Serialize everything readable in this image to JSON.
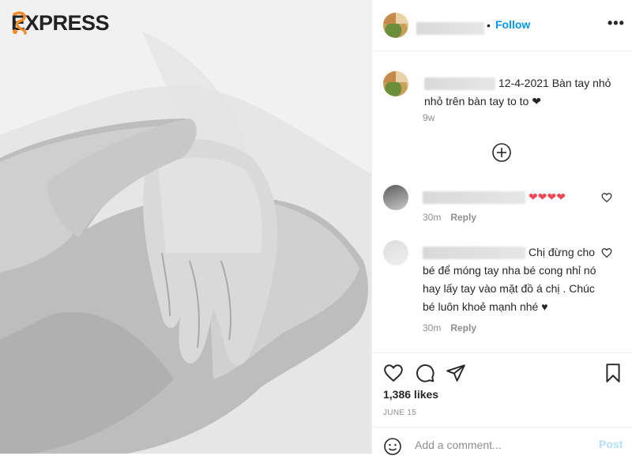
{
  "brand": {
    "name": "EXPRESS"
  },
  "header": {
    "username_hidden": true,
    "separator": "•",
    "follow_label": "Follow",
    "more": "•••"
  },
  "caption": {
    "text": "12-4-2021 Bàn tay nhỏ nhỏ trên bàn tay to to ❤",
    "age": "9w"
  },
  "load_more": {
    "icon": "plus-circle-icon"
  },
  "comments": [
    {
      "text": "❤❤❤❤",
      "time": "30m",
      "reply_label": "Reply"
    },
    {
      "text": "Chị đừng cho bé để móng tay nha bé cong nhỉ nó hay lấy tay vào mặt đồ á chị . Chúc bé luôn khoẻ mạnh nhé ♥",
      "time": "30m",
      "reply_label": "Reply"
    }
  ],
  "actions": {
    "icons": [
      "heart-icon",
      "comment-icon",
      "share-icon",
      "bookmark-icon"
    ]
  },
  "likes": "1,386 likes",
  "date": "JUNE 15",
  "add_comment": {
    "placeholder": "Add a comment...",
    "post_label": "Post"
  },
  "colors": {
    "link_blue": "#0095f6",
    "post_disabled": "#b2dffc",
    "heart_red": "#ed4956",
    "muted": "#8e8e8e"
  }
}
